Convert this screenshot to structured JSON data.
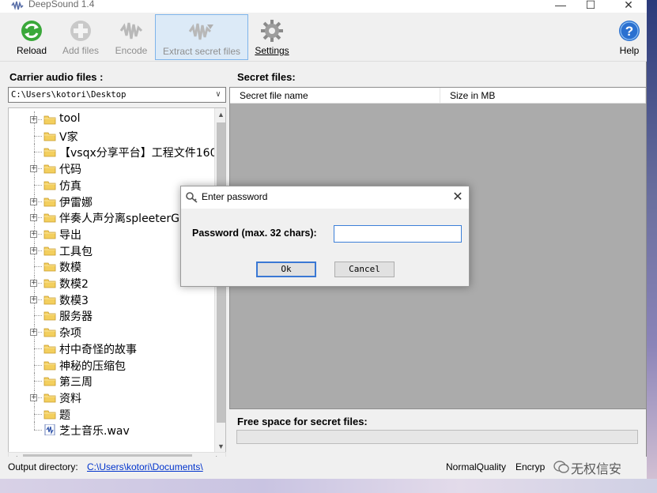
{
  "window": {
    "title": "DeepSound 1.4",
    "controls": {
      "minimize": "—",
      "maximize": "☐",
      "close": "✕"
    }
  },
  "toolbar": {
    "reload": "Reload",
    "add_files": "Add files",
    "encode": "Encode",
    "extract": "Extract secret files",
    "settings": "Settings",
    "help": "Help"
  },
  "left_pane": {
    "carrier_label": "Carrier audio files :",
    "path": "C:\\Users\\kotori\\Desktop",
    "tree": [
      {
        "label": "tool",
        "expandable": true,
        "kind": "folder"
      },
      {
        "label": "V家",
        "expandable": false,
        "kind": "folder"
      },
      {
        "label": "【vsqx分享平台】工程文件160",
        "expandable": false,
        "kind": "folder"
      },
      {
        "label": "代码",
        "expandable": true,
        "kind": "folder"
      },
      {
        "label": "仿真",
        "expandable": false,
        "kind": "folder"
      },
      {
        "label": "伊雷娜",
        "expandable": true,
        "kind": "folder"
      },
      {
        "label": "伴奏人声分离spleeterGUI",
        "expandable": true,
        "kind": "folder"
      },
      {
        "label": "导出",
        "expandable": true,
        "kind": "folder"
      },
      {
        "label": "工具包",
        "expandable": true,
        "kind": "folder"
      },
      {
        "label": "数模",
        "expandable": false,
        "kind": "folder"
      },
      {
        "label": "数模2",
        "expandable": true,
        "kind": "folder"
      },
      {
        "label": "数模3",
        "expandable": true,
        "kind": "folder"
      },
      {
        "label": "服务器",
        "expandable": false,
        "kind": "folder"
      },
      {
        "label": "杂项",
        "expandable": true,
        "kind": "folder"
      },
      {
        "label": "村中奇怪的故事",
        "expandable": false,
        "kind": "folder"
      },
      {
        "label": "神秘的压缩包",
        "expandable": false,
        "kind": "folder"
      },
      {
        "label": "第三周",
        "expandable": false,
        "kind": "folder"
      },
      {
        "label": "资料",
        "expandable": true,
        "kind": "folder"
      },
      {
        "label": "题",
        "expandable": false,
        "kind": "folder"
      },
      {
        "label": "芝士音乐.wav",
        "expandable": false,
        "kind": "audio"
      }
    ]
  },
  "right_pane": {
    "secret_label": "Secret files:",
    "columns": [
      "Secret file name",
      "Size in MB"
    ],
    "free_space_label": "Free space for secret files:"
  },
  "statusbar": {
    "output_label": "Output directory:",
    "output_path": "C:\\Users\\kotori\\Documents\\",
    "quality": "NormalQuality",
    "encryption": "Encryp",
    "watermark": "无权信安"
  },
  "dialog": {
    "title": "Enter password",
    "label": "Password (max. 32 chars):",
    "password_value": "",
    "ok": "Ok",
    "cancel": "Cancel"
  },
  "colors": {
    "accent_blue": "#3a78d4",
    "link": "#0033cc",
    "list_bg": "#ababab",
    "folder_yellow": "#f3cf5e",
    "reload_green": "#3aa83a",
    "help_blue": "#2a70d0"
  },
  "icons": {
    "reload": "reload-icon",
    "add_files": "add-files-icon",
    "encode": "encode-icon",
    "extract": "extract-icon",
    "settings": "gear-icon",
    "help": "help-icon",
    "folder": "folder-icon",
    "audio": "audio-file-icon",
    "dialog": "key-icon"
  }
}
